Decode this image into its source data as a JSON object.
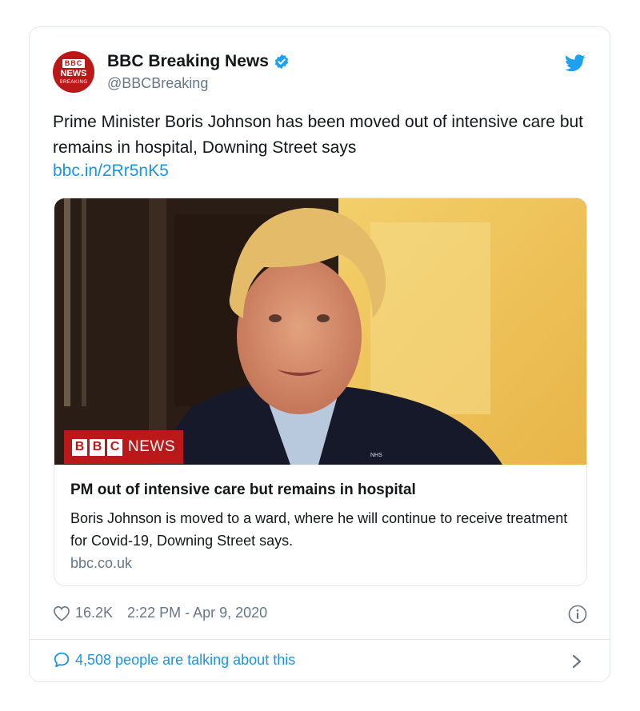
{
  "tweet": {
    "avatar": {
      "line1": "BBC",
      "line2": "NEWS",
      "line3": "BREAKING"
    },
    "display_name": "BBC Breaking News",
    "handle": "@BBCBreaking",
    "text": "Prime Minister Boris Johnson has been moved out of intensive care but remains in hospital, Downing Street says",
    "link": "bbc.in/2Rr5nK5",
    "card": {
      "logo_letters": [
        "B",
        "B",
        "C"
      ],
      "logo_word": "NEWS",
      "title": "PM out of intensive care but remains in hospital",
      "description": "Boris Johnson is moved to a ward, where he will continue to receive treatment for Covid-19, Downing Street says.",
      "domain": "bbc.co.uk"
    },
    "likes": "16.2K",
    "timestamp": "2:22 PM - Apr 9, 2020",
    "talking": "4,508 people are talking about this"
  },
  "colors": {
    "twitter_blue": "#1da1f2",
    "link_blue": "#1b95e0",
    "bbc_red": "#bb1919",
    "muted_text": "#657786"
  }
}
